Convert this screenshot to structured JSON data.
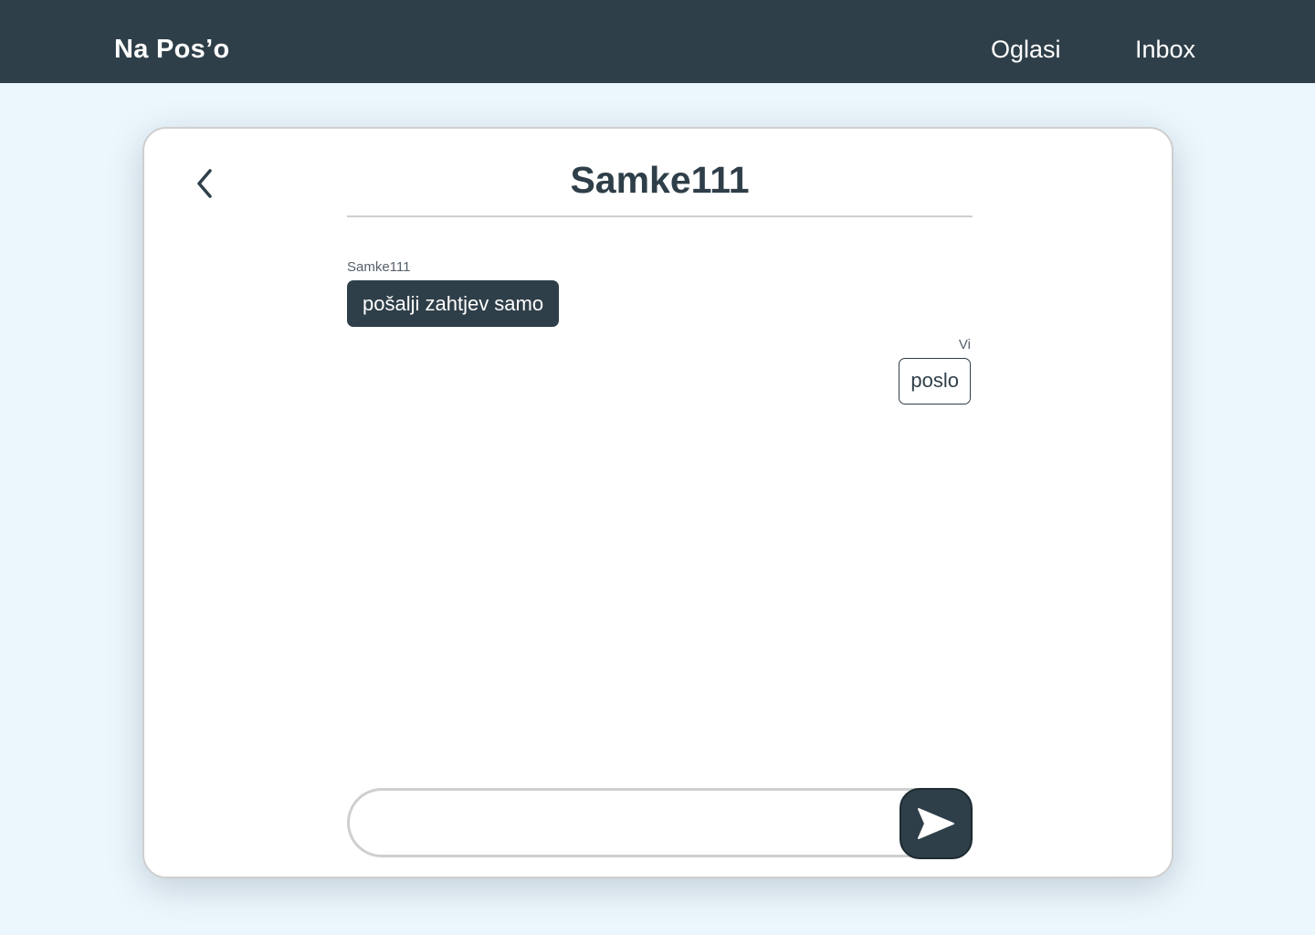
{
  "header": {
    "brand": "Na Pos’o",
    "nav": [
      {
        "label": "Oglasi"
      },
      {
        "label": "Inbox"
      }
    ]
  },
  "chat": {
    "title": "Samke111",
    "back_icon": "chevron-left-icon",
    "messages": [
      {
        "sender": "Samke111",
        "text": "pošalji zahtjev samo",
        "from_me": false
      },
      {
        "sender": "Vi",
        "text": "poslo",
        "from_me": true
      }
    ],
    "compose": {
      "value": "",
      "placeholder": "",
      "send_icon": "send-icon"
    }
  },
  "colors": {
    "primary": "#2f3f49",
    "background": "#ecf7fd",
    "card": "#ffffff",
    "border": "#cfcfcf"
  }
}
